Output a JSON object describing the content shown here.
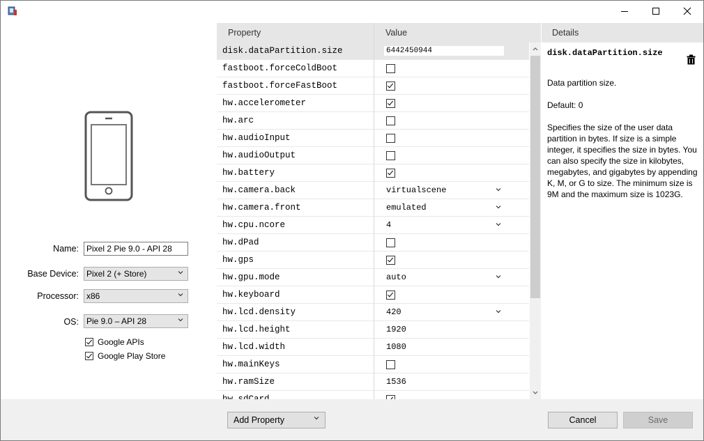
{
  "window": {
    "buttons": [
      "minimize",
      "maximize",
      "close"
    ]
  },
  "device_form": {
    "name_label": "Name:",
    "name_value": "Pixel 2 Pie 9.0 - API 28",
    "base_device_label": "Base Device:",
    "base_device_value": "Pixel 2 (+ Store)",
    "processor_label": "Processor:",
    "processor_value": "x86",
    "os_label": "OS:",
    "os_value": "Pie 9.0 – API 28",
    "google_apis_label": "Google APIs",
    "google_apis_checked": true,
    "google_play_label": "Google Play Store",
    "google_play_checked": true
  },
  "grid": {
    "property_header": "Property",
    "value_header": "Value",
    "rows": [
      {
        "name": "disk.dataPartition.size",
        "kind": "input",
        "value": "6442450944",
        "selected": true
      },
      {
        "name": "fastboot.forceColdBoot",
        "kind": "check",
        "checked": false
      },
      {
        "name": "fastboot.forceFastBoot",
        "kind": "check",
        "checked": true
      },
      {
        "name": "hw.accelerometer",
        "kind": "check",
        "checked": true
      },
      {
        "name": "hw.arc",
        "kind": "check",
        "checked": false
      },
      {
        "name": "hw.audioInput",
        "kind": "check",
        "checked": false
      },
      {
        "name": "hw.audioOutput",
        "kind": "check",
        "checked": false
      },
      {
        "name": "hw.battery",
        "kind": "check",
        "checked": true
      },
      {
        "name": "hw.camera.back",
        "kind": "select",
        "value": "virtualscene"
      },
      {
        "name": "hw.camera.front",
        "kind": "select",
        "value": "emulated"
      },
      {
        "name": "hw.cpu.ncore",
        "kind": "select",
        "value": "4"
      },
      {
        "name": "hw.dPad",
        "kind": "check",
        "checked": false
      },
      {
        "name": "hw.gps",
        "kind": "check",
        "checked": true
      },
      {
        "name": "hw.gpu.mode",
        "kind": "select",
        "value": "auto"
      },
      {
        "name": "hw.keyboard",
        "kind": "check",
        "checked": true
      },
      {
        "name": "hw.lcd.density",
        "kind": "select",
        "value": "420"
      },
      {
        "name": "hw.lcd.height",
        "kind": "text",
        "value": "1920"
      },
      {
        "name": "hw.lcd.width",
        "kind": "text",
        "value": "1080"
      },
      {
        "name": "hw.mainKeys",
        "kind": "check",
        "checked": false
      },
      {
        "name": "hw.ramSize",
        "kind": "text",
        "value": "1536"
      },
      {
        "name": "hw.sdCard",
        "kind": "check",
        "checked": true
      }
    ]
  },
  "details": {
    "header": "Details",
    "title": "disk.dataPartition.size",
    "summary": "Data partition size.",
    "default": "Default: 0",
    "description": "Specifies the size of the user data partition in bytes. If size is a simple integer, it specifies the size in bytes. You can also specify the size in kilobytes, megabytes, and gigabytes by appending K, M, or G to size. The minimum size is 9M and the maximum size is 1023G."
  },
  "footer": {
    "add_property_label": "Add Property",
    "cancel_label": "Cancel",
    "save_label": "Save"
  },
  "colors": {
    "selected_row": "#e6e6e6",
    "header_bg": "#e6e6e6",
    "footer_bg": "#f0f0f0"
  }
}
